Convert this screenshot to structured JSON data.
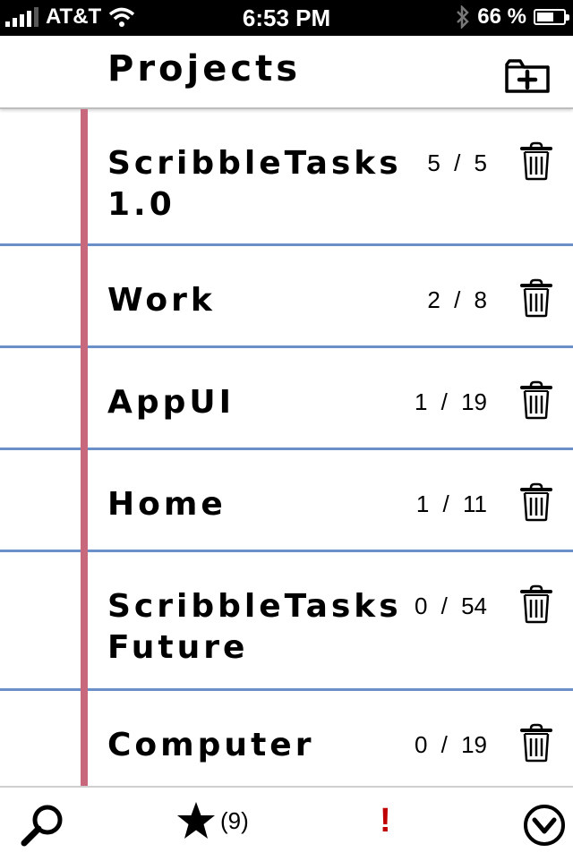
{
  "status_bar": {
    "carrier": "AT&T",
    "time": "6:53 PM",
    "battery": "66 %",
    "battery_level": 0.66
  },
  "header": {
    "title": "Projects",
    "add_icon": "folder-add-icon"
  },
  "projects": [
    {
      "name": "ScribbleTasks 1.0",
      "count": "5 / 5"
    },
    {
      "name": "Work",
      "count": "2 / 8"
    },
    {
      "name": "AppUI",
      "count": "1 / 19"
    },
    {
      "name": "Home",
      "count": "1 / 11"
    },
    {
      "name": "ScribbleTasks Future",
      "count": "0 / 54"
    },
    {
      "name": "Computer",
      "count": "0 / 19"
    }
  ],
  "toolbar": {
    "search_icon": "search-icon",
    "star_icon": "star-icon",
    "star_count": "(9)",
    "priority_label": "!",
    "chevron_icon": "chevron-down-circle-icon"
  },
  "colors": {
    "margin_line": "#c8687c",
    "row_line": "#6b8fc8",
    "priority": "#c00000"
  }
}
